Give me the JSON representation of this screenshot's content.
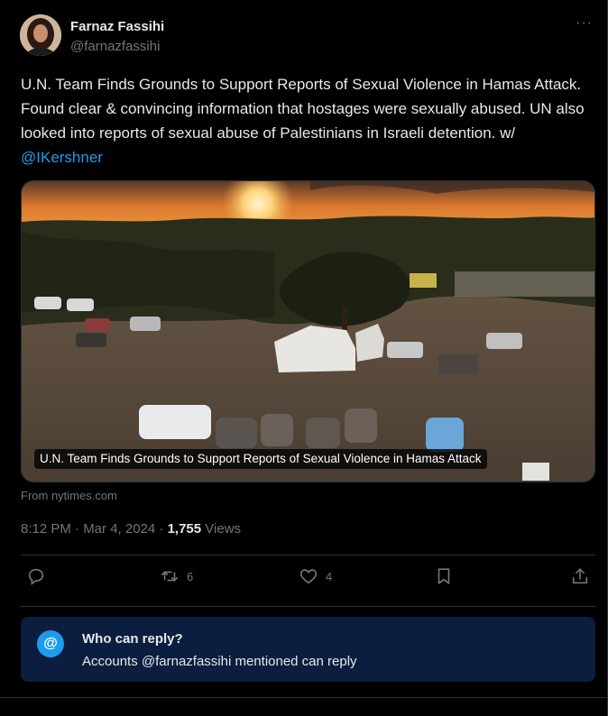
{
  "author": {
    "display_name": "Farnaz Fassihi",
    "handle": "@farnazfassihi",
    "avatar_icon": "avatar"
  },
  "tweet": {
    "text_before": "U.N. Team Finds Grounds to Support Reports of Sexual Violence in Hamas Attack. Found clear & convincing information that hostages were sexually abused. UN also looked into reports of sexual abuse of Palestinians in Israeli detention. w/ ",
    "mention": "@IKershner"
  },
  "link_card": {
    "caption": "U.N. Team Finds Grounds to Support Reports of Sexual Violence in Hamas Attack",
    "source": "From nytimes.com"
  },
  "meta": {
    "time_date": "8:12 PM · Mar 4, 2024 · ",
    "views_count": "1,755",
    "views_label": " Views"
  },
  "actions": {
    "reply_icon": "reply-icon",
    "retweet_count": "6",
    "like_count": "4",
    "bookmark_icon": "bookmark-icon",
    "share_icon": "share-icon"
  },
  "reply_restriction": {
    "icon": "@",
    "title": "Who can reply?",
    "subtitle": "Accounts @farnazfassihi mentioned can reply"
  },
  "colors": {
    "accent": "#1d9bf0",
    "muted": "#71767b",
    "reply_box_bg": "#0b1e3f"
  }
}
